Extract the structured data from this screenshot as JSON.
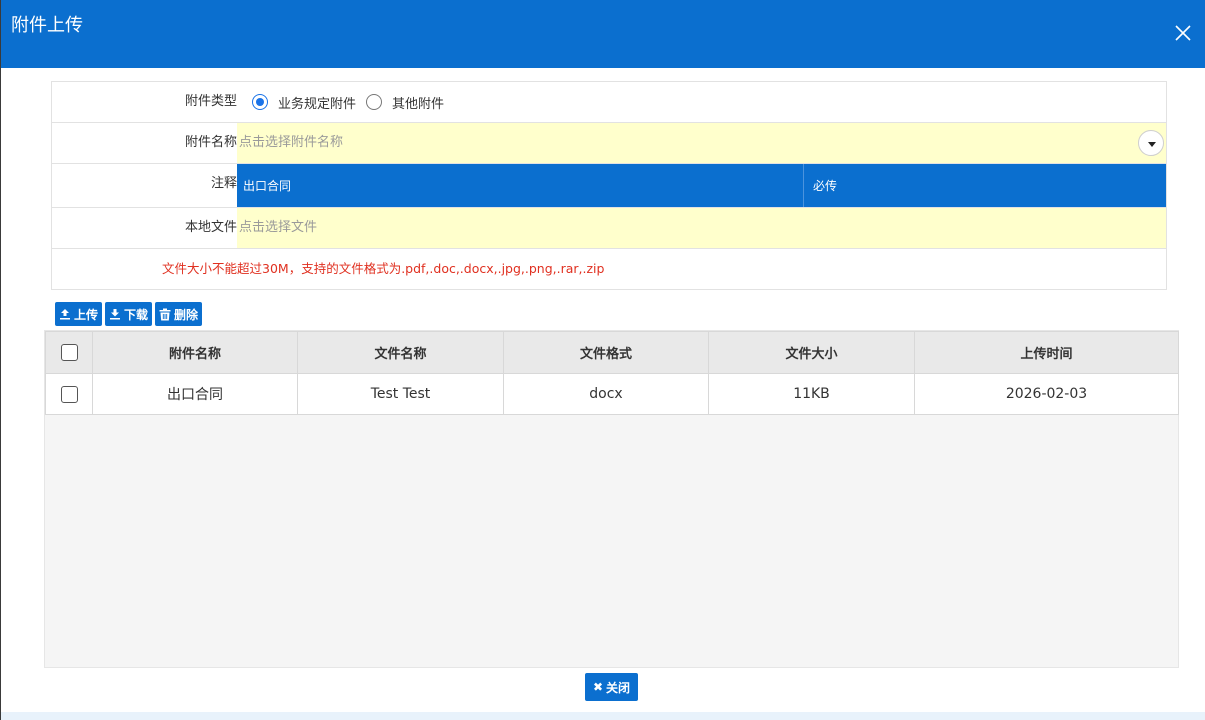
{
  "dialog": {
    "title": "附件上传"
  },
  "form": {
    "type_label": "附件类型",
    "type_options": [
      {
        "label": "业务规定附件",
        "checked": true
      },
      {
        "label": "其他附件",
        "checked": false
      }
    ],
    "name_label": "附件名称",
    "name_placeholder": "点击选择附件名称",
    "note_label": "注释",
    "note_value": "出口合同",
    "note_required": "必传",
    "file_label": "本地文件",
    "file_placeholder": "点击选择文件",
    "hint": "文件大小不能超过30M，支持的文件格式为.pdf,.doc,.docx,.jpg,.png,.rar,.zip"
  },
  "toolbar": {
    "upload_label": "上传",
    "download_label": "下载",
    "delete_label": "删除"
  },
  "grid": {
    "columns": [
      "附件名称",
      "文件名称",
      "文件格式",
      "文件大小",
      "上传时间"
    ],
    "rows": [
      {
        "attachment_name": "出口合同",
        "file_name": "Test Test",
        "format": "docx",
        "size": "11KB",
        "uploaded": "2026-02-03"
      }
    ]
  },
  "footer": {
    "close_label": "关闭"
  },
  "colors": {
    "accent": "#0b6fcf",
    "input_bg": "#ffffcc",
    "hint": "#e03020"
  },
  "icons": {
    "close": "close-icon",
    "upload": "upload-icon",
    "download": "download-icon",
    "delete": "trash-icon",
    "dropdown": "caret-down-icon"
  }
}
